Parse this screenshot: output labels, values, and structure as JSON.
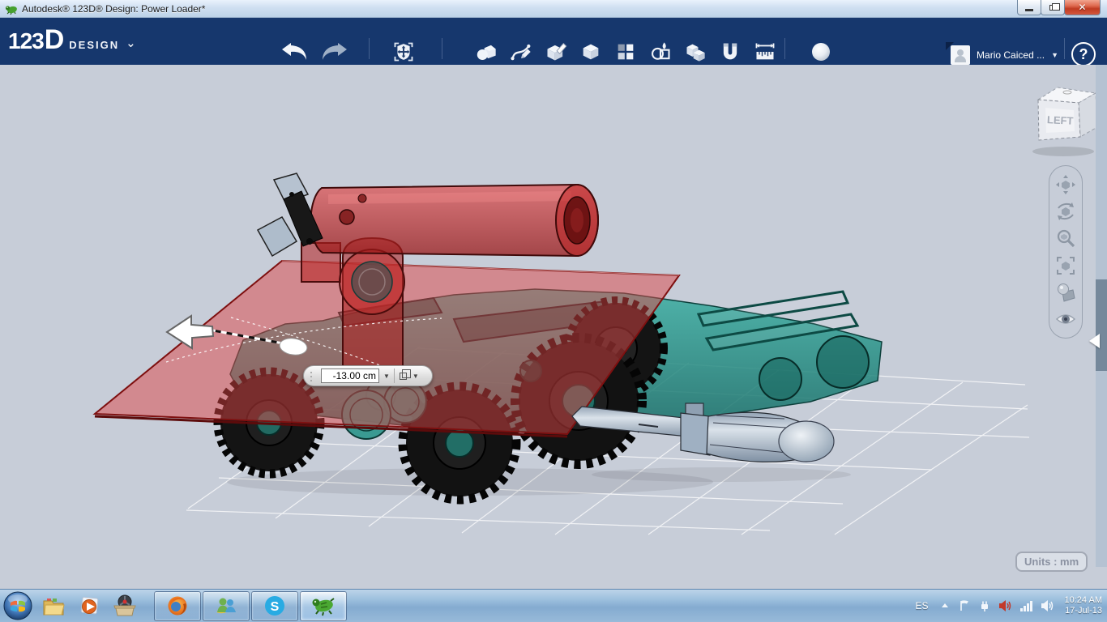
{
  "window": {
    "title": "Autodesk® 123D® Design: Power Loader*",
    "controls": [
      "minimize",
      "restore",
      "close"
    ]
  },
  "toolbar": {
    "logo": {
      "numbers": "123",
      "d": "D",
      "product": "DESIGN",
      "caret": "⌄"
    },
    "tools": [
      "transform",
      "primitives",
      "sketch",
      "construct",
      "modify",
      "pattern",
      "grouping",
      "combine",
      "snap",
      "measure"
    ],
    "history": [
      "undo",
      "redo"
    ],
    "material_tool": "material-sphere",
    "user": {
      "name": "Mario Caiced ...",
      "help_label": "?"
    },
    "colors": {
      "background": "#16376d",
      "icon": "#f0f3f8"
    }
  },
  "viewport": {
    "viewcube_label": "LEFT",
    "units_label": "Units : mm",
    "dimension_input": {
      "value": "-13.00 cm"
    },
    "nav_tools": [
      "pan",
      "orbit",
      "zoom",
      "fit",
      "material",
      "visibility"
    ],
    "background": "#c7cdd8",
    "scene_parts": [
      "rover-body",
      "red-plane",
      "cannon-assembly",
      "crank-handle",
      "missile",
      "move-arrow-manipulator",
      "ground-grid"
    ],
    "colors": {
      "rover_teal": "#2e9a8e",
      "cannon_red": "#c32a2a",
      "missile_gray": "#a9b8c8",
      "grid": "#ffffff"
    }
  },
  "taskbar": {
    "apps": [
      "start",
      "explorer",
      "media-player",
      "parts-box",
      "firefox",
      "messenger",
      "skype",
      "123d-design"
    ],
    "active_app": "123d-design",
    "skype_letter": "S",
    "tray": {
      "language": "ES",
      "icons": [
        "hidden-icons",
        "action-center-flag",
        "power-plug",
        "audio-manager",
        "network",
        "volume"
      ],
      "time": "10:24 AM",
      "date": "17-Jul-13"
    }
  }
}
